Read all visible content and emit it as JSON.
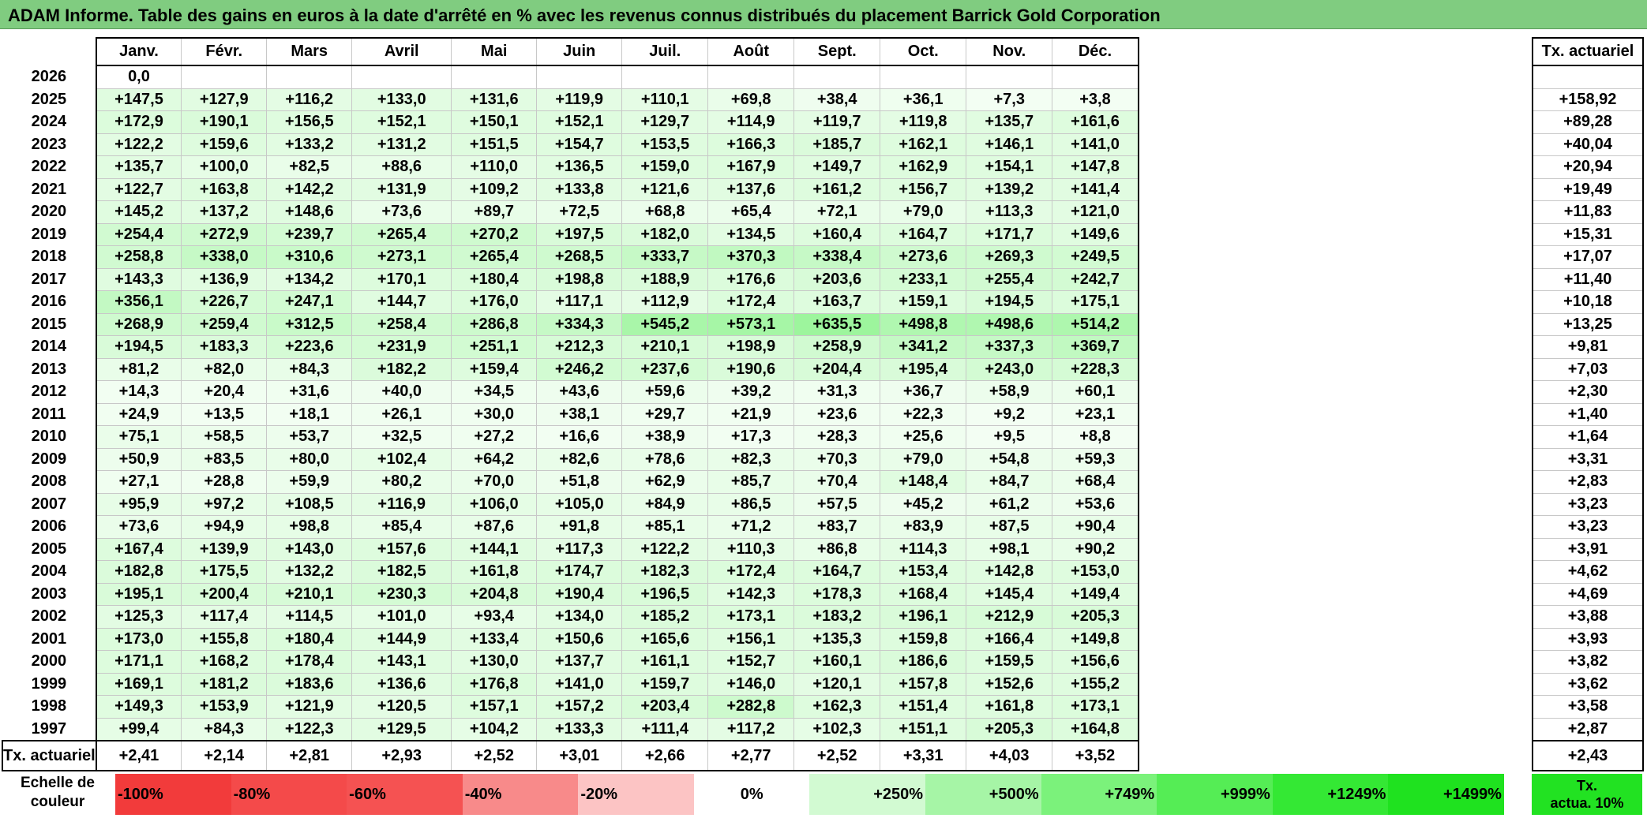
{
  "title": "ADAM Informe. Table des gains en euros à la date d'arrêté en % avec les revenus connus distribués du placement Barrick Gold Corporation",
  "months": [
    "Janv.",
    "Févr.",
    "Mars",
    "Avril",
    "Mai",
    "Juin",
    "Juil.",
    "Août",
    "Sept.",
    "Oct.",
    "Nov.",
    "Déc."
  ],
  "side_header": "Tx. actuariel",
  "rows": [
    {
      "year": "2026",
      "values": [
        "0,0"
      ],
      "rate": ""
    },
    {
      "year": "2025",
      "values": [
        "+147,5",
        "+127,9",
        "+116,2",
        "+133,0",
        "+131,6",
        "+119,9",
        "+110,1",
        "+69,8",
        "+38,4",
        "+36,1",
        "+7,3",
        "+3,8"
      ],
      "rate": "+158,92"
    },
    {
      "year": "2024",
      "values": [
        "+172,9",
        "+190,1",
        "+156,5",
        "+152,1",
        "+150,1",
        "+152,1",
        "+129,7",
        "+114,9",
        "+119,7",
        "+119,8",
        "+135,7",
        "+161,6"
      ],
      "rate": "+89,28"
    },
    {
      "year": "2023",
      "values": [
        "+122,2",
        "+159,6",
        "+133,2",
        "+131,2",
        "+151,5",
        "+154,7",
        "+153,5",
        "+166,3",
        "+185,7",
        "+162,1",
        "+146,1",
        "+141,0"
      ],
      "rate": "+40,04"
    },
    {
      "year": "2022",
      "values": [
        "+135,7",
        "+100,0",
        "+82,5",
        "+88,6",
        "+110,0",
        "+136,5",
        "+159,0",
        "+167,9",
        "+149,7",
        "+162,9",
        "+154,1",
        "+147,8"
      ],
      "rate": "+20,94"
    },
    {
      "year": "2021",
      "values": [
        "+122,7",
        "+163,8",
        "+142,2",
        "+131,9",
        "+109,2",
        "+133,8",
        "+121,6",
        "+137,6",
        "+161,2",
        "+156,7",
        "+139,2",
        "+141,4"
      ],
      "rate": "+19,49"
    },
    {
      "year": "2020",
      "values": [
        "+145,2",
        "+137,2",
        "+148,6",
        "+73,6",
        "+89,7",
        "+72,5",
        "+68,8",
        "+65,4",
        "+72,1",
        "+79,0",
        "+113,3",
        "+121,0"
      ],
      "rate": "+11,83"
    },
    {
      "year": "2019",
      "values": [
        "+254,4",
        "+272,9",
        "+239,7",
        "+265,4",
        "+270,2",
        "+197,5",
        "+182,0",
        "+134,5",
        "+160,4",
        "+164,7",
        "+171,7",
        "+149,6"
      ],
      "rate": "+15,31"
    },
    {
      "year": "2018",
      "values": [
        "+258,8",
        "+338,0",
        "+310,6",
        "+273,1",
        "+265,4",
        "+268,5",
        "+333,7",
        "+370,3",
        "+338,4",
        "+273,6",
        "+269,3",
        "+249,5"
      ],
      "rate": "+17,07"
    },
    {
      "year": "2017",
      "values": [
        "+143,3",
        "+136,9",
        "+134,2",
        "+170,1",
        "+180,4",
        "+198,8",
        "+188,9",
        "+176,6",
        "+203,6",
        "+233,1",
        "+255,4",
        "+242,7"
      ],
      "rate": "+11,40"
    },
    {
      "year": "2016",
      "values": [
        "+356,1",
        "+226,7",
        "+247,1",
        "+144,7",
        "+176,0",
        "+117,1",
        "+112,9",
        "+172,4",
        "+163,7",
        "+159,1",
        "+194,5",
        "+175,1"
      ],
      "rate": "+10,18"
    },
    {
      "year": "2015",
      "values": [
        "+268,9",
        "+259,4",
        "+312,5",
        "+258,4",
        "+286,8",
        "+334,3",
        "+545,2",
        "+573,1",
        "+635,5",
        "+498,8",
        "+498,6",
        "+514,2"
      ],
      "rate": "+13,25"
    },
    {
      "year": "2014",
      "values": [
        "+194,5",
        "+183,3",
        "+223,6",
        "+231,9",
        "+251,1",
        "+212,3",
        "+210,1",
        "+198,9",
        "+258,9",
        "+341,2",
        "+337,3",
        "+369,7"
      ],
      "rate": "+9,81"
    },
    {
      "year": "2013",
      "values": [
        "+81,2",
        "+82,0",
        "+84,3",
        "+182,2",
        "+159,4",
        "+246,2",
        "+237,6",
        "+190,6",
        "+204,4",
        "+195,4",
        "+243,0",
        "+228,3"
      ],
      "rate": "+7,03"
    },
    {
      "year": "2012",
      "values": [
        "+14,3",
        "+20,4",
        "+31,6",
        "+40,0",
        "+34,5",
        "+43,6",
        "+59,6",
        "+39,2",
        "+31,3",
        "+36,7",
        "+58,9",
        "+60,1"
      ],
      "rate": "+2,30"
    },
    {
      "year": "2011",
      "values": [
        "+24,9",
        "+13,5",
        "+18,1",
        "+26,1",
        "+30,0",
        "+38,1",
        "+29,7",
        "+21,9",
        "+23,6",
        "+22,3",
        "+9,2",
        "+23,1"
      ],
      "rate": "+1,40"
    },
    {
      "year": "2010",
      "values": [
        "+75,1",
        "+58,5",
        "+53,7",
        "+32,5",
        "+27,2",
        "+16,6",
        "+38,9",
        "+17,3",
        "+28,3",
        "+25,6",
        "+9,5",
        "+8,8"
      ],
      "rate": "+1,64"
    },
    {
      "year": "2009",
      "values": [
        "+50,9",
        "+83,5",
        "+80,0",
        "+102,4",
        "+64,2",
        "+82,6",
        "+78,6",
        "+82,3",
        "+70,3",
        "+79,0",
        "+54,8",
        "+59,3"
      ],
      "rate": "+3,31"
    },
    {
      "year": "2008",
      "values": [
        "+27,1",
        "+28,8",
        "+59,9",
        "+80,2",
        "+70,0",
        "+51,8",
        "+62,9",
        "+85,7",
        "+70,4",
        "+148,4",
        "+84,7",
        "+68,4"
      ],
      "rate": "+2,83"
    },
    {
      "year": "2007",
      "values": [
        "+95,9",
        "+97,2",
        "+108,5",
        "+116,9",
        "+106,0",
        "+105,0",
        "+84,9",
        "+86,5",
        "+57,5",
        "+45,2",
        "+61,2",
        "+53,6"
      ],
      "rate": "+3,23"
    },
    {
      "year": "2006",
      "values": [
        "+73,6",
        "+94,9",
        "+98,8",
        "+85,4",
        "+87,6",
        "+91,8",
        "+85,1",
        "+71,2",
        "+83,7",
        "+83,9",
        "+87,5",
        "+90,4"
      ],
      "rate": "+3,23"
    },
    {
      "year": "2005",
      "values": [
        "+167,4",
        "+139,9",
        "+143,0",
        "+157,6",
        "+144,1",
        "+117,3",
        "+122,2",
        "+110,3",
        "+86,8",
        "+114,3",
        "+98,1",
        "+90,2"
      ],
      "rate": "+3,91"
    },
    {
      "year": "2004",
      "values": [
        "+182,8",
        "+175,5",
        "+132,2",
        "+182,5",
        "+161,8",
        "+174,7",
        "+182,3",
        "+172,4",
        "+164,7",
        "+153,4",
        "+142,8",
        "+153,0"
      ],
      "rate": "+4,62"
    },
    {
      "year": "2003",
      "values": [
        "+195,1",
        "+200,4",
        "+210,1",
        "+230,3",
        "+204,8",
        "+190,4",
        "+196,5",
        "+142,3",
        "+178,3",
        "+168,4",
        "+145,4",
        "+149,4"
      ],
      "rate": "+4,69"
    },
    {
      "year": "2002",
      "values": [
        "+125,3",
        "+117,4",
        "+114,5",
        "+101,0",
        "+93,4",
        "+134,0",
        "+185,2",
        "+173,1",
        "+183,2",
        "+196,1",
        "+212,9",
        "+205,3"
      ],
      "rate": "+3,88"
    },
    {
      "year": "2001",
      "values": [
        "+173,0",
        "+155,8",
        "+180,4",
        "+144,9",
        "+133,4",
        "+150,6",
        "+165,6",
        "+156,1",
        "+135,3",
        "+159,8",
        "+166,4",
        "+149,8"
      ],
      "rate": "+3,93"
    },
    {
      "year": "2000",
      "values": [
        "+171,1",
        "+168,2",
        "+178,4",
        "+143,1",
        "+130,0",
        "+137,7",
        "+161,1",
        "+152,7",
        "+160,1",
        "+186,6",
        "+159,5",
        "+156,6"
      ],
      "rate": "+3,82"
    },
    {
      "year": "1999",
      "values": [
        "+169,1",
        "+181,2",
        "+183,6",
        "+136,6",
        "+176,8",
        "+141,0",
        "+159,7",
        "+146,0",
        "+120,1",
        "+157,8",
        "+152,6",
        "+155,2"
      ],
      "rate": "+3,62"
    },
    {
      "year": "1998",
      "values": [
        "+149,3",
        "+153,9",
        "+121,9",
        "+120,5",
        "+157,1",
        "+157,2",
        "+203,4",
        "+282,8",
        "+162,3",
        "+151,4",
        "+161,8",
        "+173,1"
      ],
      "rate": "+3,58"
    },
    {
      "year": "1997",
      "values": [
        "+99,4",
        "+84,3",
        "+122,3",
        "+129,5",
        "+104,2",
        "+133,3",
        "+111,4",
        "+117,2",
        "+102,3",
        "+151,1",
        "+205,3",
        "+164,8"
      ],
      "rate": "+2,87"
    }
  ],
  "totals": {
    "label": "Tx. actuariel",
    "values": [
      "+2,41",
      "+2,14",
      "+2,81",
      "+2,93",
      "+2,52",
      "+3,01",
      "+2,66",
      "+2,77",
      "+2,52",
      "+3,31",
      "+4,03",
      "+3,52"
    ],
    "rate": "+2,43"
  },
  "scale": {
    "label_line1": "Echelle de",
    "label_line2": "couleur",
    "items": [
      {
        "label": "-100%",
        "color": "#f23b3b",
        "align": "left"
      },
      {
        "label": "-80%",
        "color": "#f44a4a",
        "align": "left"
      },
      {
        "label": "-60%",
        "color": "#f55252",
        "align": "left"
      },
      {
        "label": "-40%",
        "color": "#f88a8a",
        "align": "left"
      },
      {
        "label": "-20%",
        "color": "#fcc4c4",
        "align": "left"
      },
      {
        "label": "0%",
        "color": "#ffffff",
        "align": "center"
      },
      {
        "label": "+250%",
        "color": "#d2fad2",
        "align": "right"
      },
      {
        "label": "+500%",
        "color": "#a6f5a6",
        "align": "right"
      },
      {
        "label": "+749%",
        "color": "#7bf27b",
        "align": "right"
      },
      {
        "label": "+999%",
        "color": "#55ed55",
        "align": "right"
      },
      {
        "label": "+1249%",
        "color": "#34e834",
        "align": "right"
      },
      {
        "label": "+1499%",
        "color": "#1fe21f",
        "align": "right"
      }
    ],
    "actua_line1": "Tx.",
    "actua_line2": "actua. 10%"
  }
}
